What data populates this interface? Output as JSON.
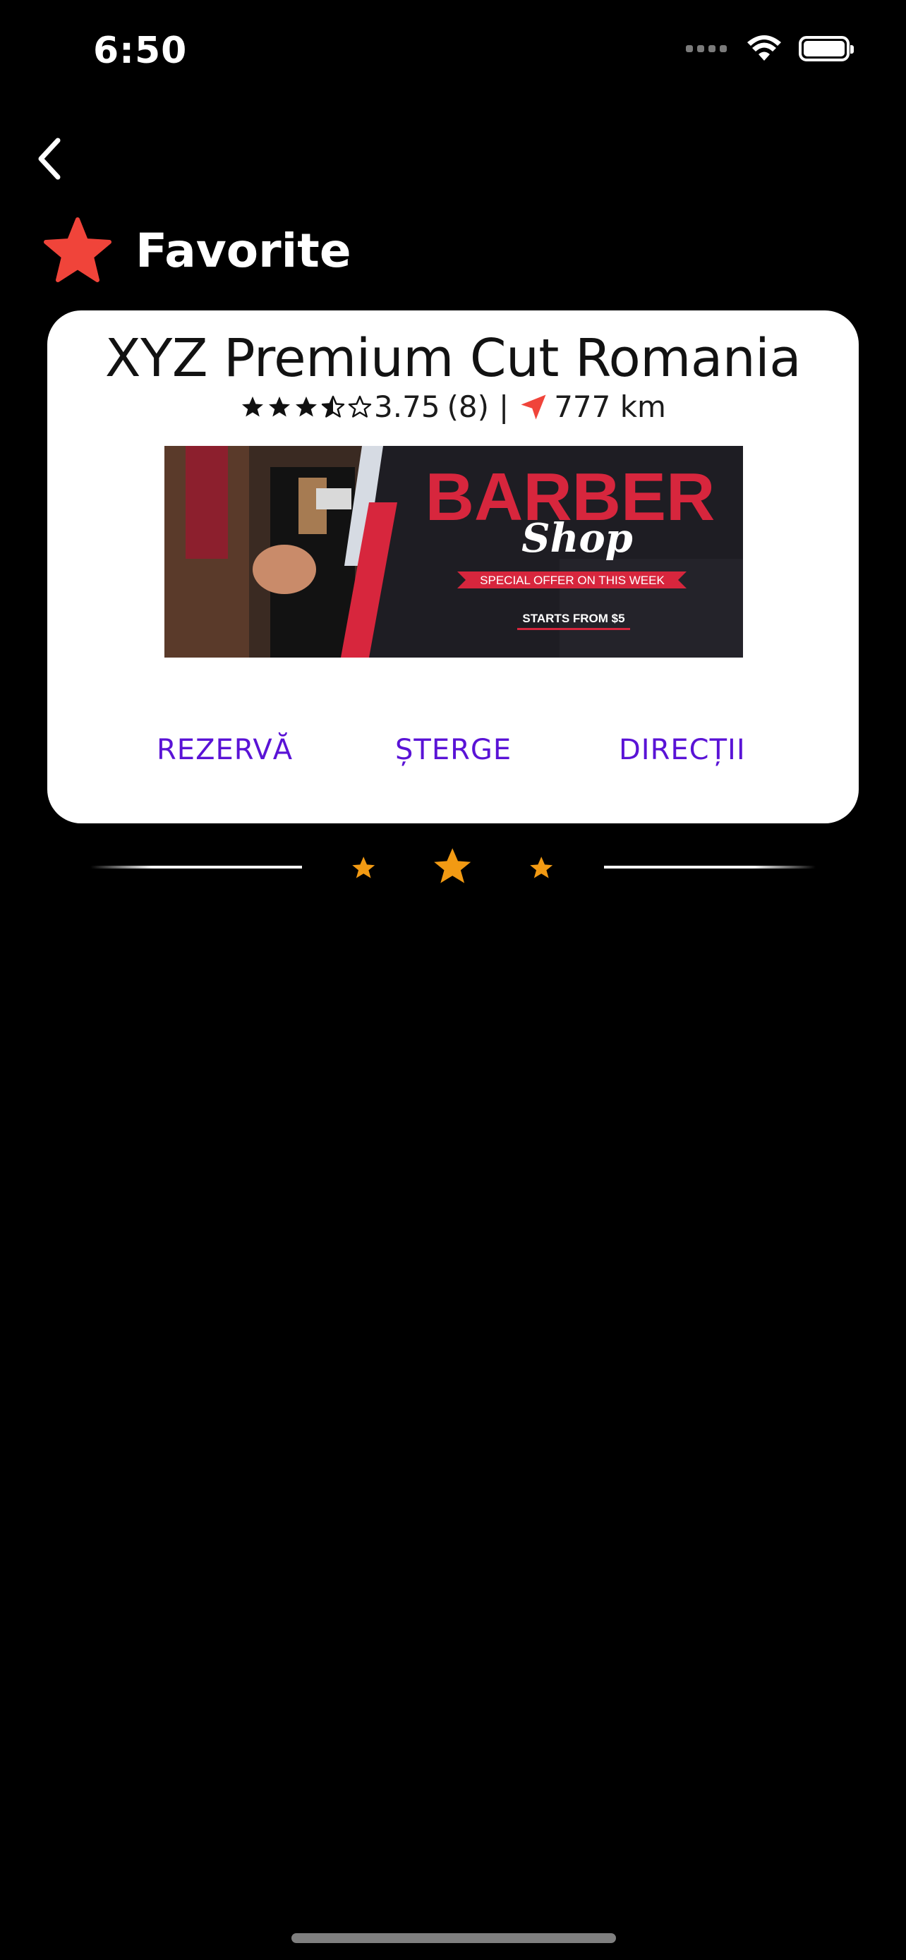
{
  "status_bar": {
    "time": "6:50",
    "icons": [
      "signal-icon",
      "wifi-icon",
      "battery-icon"
    ]
  },
  "nav": {
    "back_icon": "chevron-left-icon"
  },
  "header": {
    "title": "Favorite",
    "icon": "star-icon",
    "icon_color": "#f0443a"
  },
  "card": {
    "title": "XYZ Premium Cut Romania",
    "rating": "3.75",
    "rating_value": 3.5,
    "rating_max": 5,
    "reviews": "(8)",
    "separator": "|",
    "distance": "777 km",
    "distance_icon_color": "#f0443a",
    "image": {
      "headline": "BARBER",
      "script": "Shop",
      "ribbon": "SPECIAL OFFER ON THIS WEEK",
      "footer": "STARTS FROM $5"
    },
    "actions": [
      {
        "label": "REZERVĂ"
      },
      {
        "label": "ȘTERGE"
      },
      {
        "label": "DIRECȚII"
      }
    ],
    "action_color": "#5a13d6"
  },
  "divider": {
    "star_color": "#f29a13"
  }
}
